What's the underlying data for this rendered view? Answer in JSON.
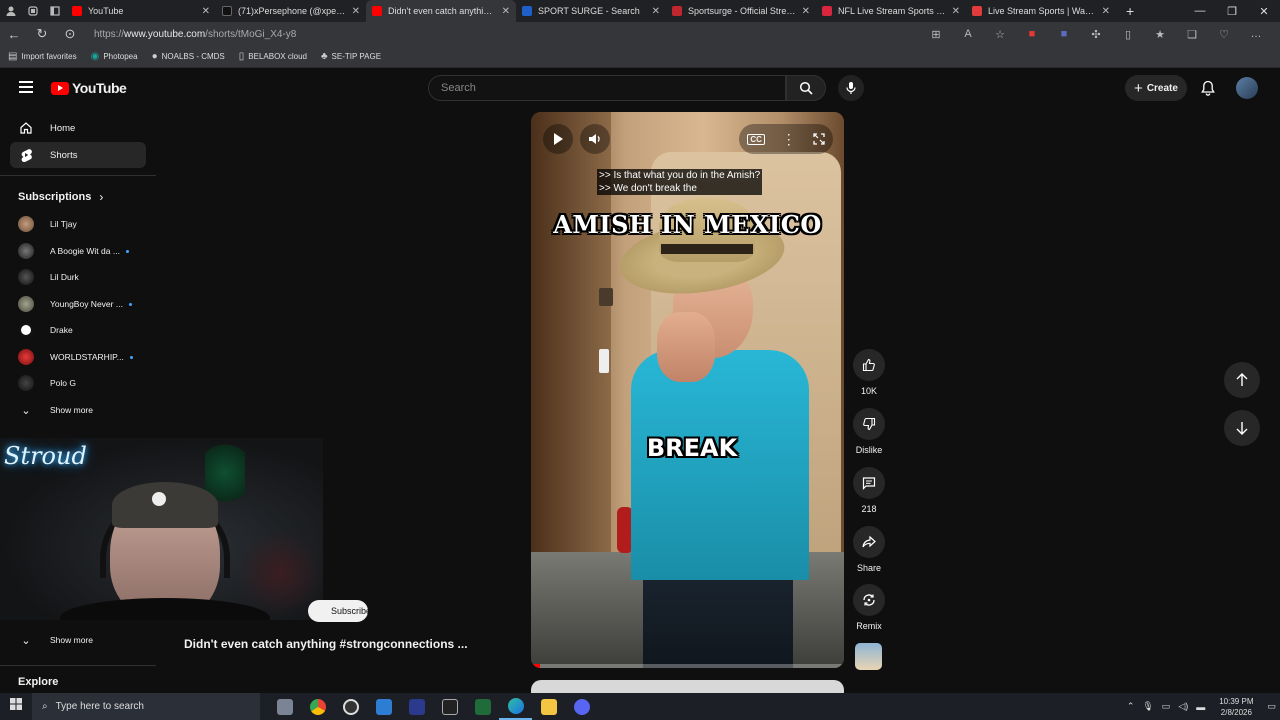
{
  "browser": {
    "tabs": [
      {
        "title": "YouTube",
        "color": "#ff0000",
        "active": false
      },
      {
        "title": "(71)xPersephone (@xpersephone",
        "color": "#111111",
        "active": false
      },
      {
        "title": "Didn't even catch anything #st",
        "color": "#ff0000",
        "active": true
      },
      {
        "title": "SPORT SURGE - Search",
        "color": "#1e5fc9",
        "active": false
      },
      {
        "title": "Sportsurge - Official Streams",
        "color": "#c0262d",
        "active": false
      },
      {
        "title": "NFL Live Stream Sports | Watch",
        "color": "#d7263d",
        "active": false
      },
      {
        "title": "Live Stream Sports | Watchspo",
        "color": "#e23b3b",
        "active": false
      }
    ],
    "url_prefix": "https://",
    "url_host": "www.youtube.com",
    "url_path": "/shorts/tMoGi_X4-y8",
    "bookmarks": [
      "Import favorites",
      "Photopea",
      "NOALBS - CMDS",
      "BELABOX cloud",
      "SE-TIP PAGE"
    ]
  },
  "header": {
    "logo_text": "YouTube",
    "search_placeholder": "Search",
    "create_label": "Create"
  },
  "sidebar": {
    "items": [
      {
        "label": "Home",
        "icon": "home-icon"
      },
      {
        "label": "Shorts",
        "icon": "shorts-icon"
      }
    ],
    "subscriptions_label": "Subscriptions",
    "subscriptions": [
      {
        "name": "Lil Tjay",
        "color": "#9b7a62",
        "live": false
      },
      {
        "name": "A Boogie Wit da ...",
        "color": "#3b3b3b",
        "live": true
      },
      {
        "name": "Lil Durk",
        "color": "#222222",
        "live": false
      },
      {
        "name": "YoungBoy Never ...",
        "color": "#6b6b5b",
        "live": true
      },
      {
        "name": "Drake",
        "color": "#ffffff",
        "live": false
      },
      {
        "name": "WORLDSTARHIP...",
        "color": "#b3141a",
        "live": true
      },
      {
        "name": "Polo G",
        "color": "#2a2a2a",
        "live": false
      }
    ],
    "show_more": "Show more",
    "show_more_2": "Show more",
    "explore": "Explore"
  },
  "webcam": {
    "neon_text": "Stroud"
  },
  "short": {
    "caption_line1": ">> Is that what you do in the Amish?",
    "caption_line2": ">> We don't break the",
    "overlay_title": "AMISH IN MEXICO",
    "overlay_word": "BREAK",
    "title": "Didn't even catch anything #strongconnections ...",
    "subscribe_label": "Subscribe",
    "progress": 0.03
  },
  "actions": {
    "like_count": "10K",
    "dislike_label": "Dislike",
    "comment_count": "218",
    "share_label": "Share",
    "remix_label": "Remix"
  },
  "taskbar": {
    "search_placeholder": "Type here to search",
    "time": "10:39 PM",
    "date": "2/8/2026"
  }
}
